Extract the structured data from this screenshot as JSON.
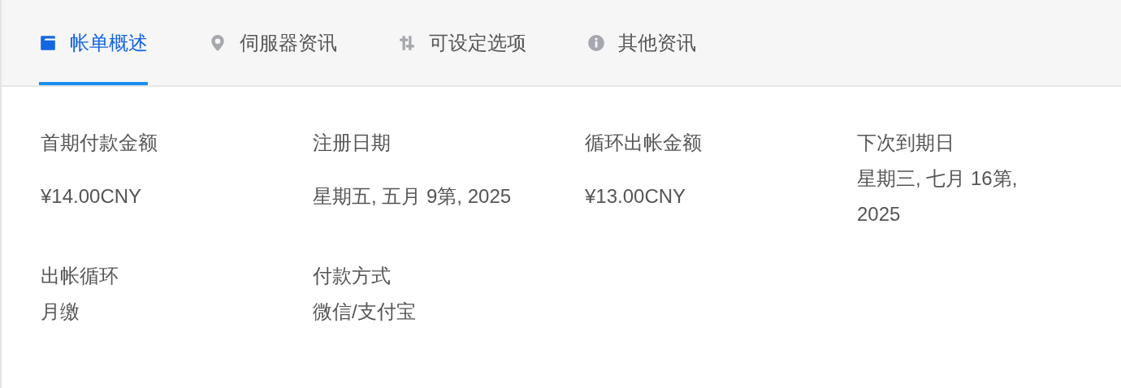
{
  "tabs": [
    {
      "label": "帐单概述",
      "kind": "wallet",
      "selected": true
    },
    {
      "label": "伺服器资讯",
      "kind": "pin",
      "selected": false
    },
    {
      "label": "可设定选项",
      "kind": "sliders",
      "selected": false
    },
    {
      "label": "其他资讯",
      "kind": "info",
      "selected": false
    }
  ],
  "fields": [
    [
      {
        "label": "首期付款金额",
        "value": "¥14.00CNY"
      },
      {
        "label": "注册日期",
        "value": "星期五, 五月 9第, 2025"
      },
      {
        "label": "循环出帐金额",
        "value": "¥13.00CNY"
      },
      {
        "label": "下次到期日",
        "value": "星期三, 七月 16第, 2025"
      }
    ],
    [
      {
        "label": "出帐循环",
        "value": "月缴"
      },
      {
        "label": "付款方式",
        "value": "微信/支付宝"
      }
    ]
  ]
}
